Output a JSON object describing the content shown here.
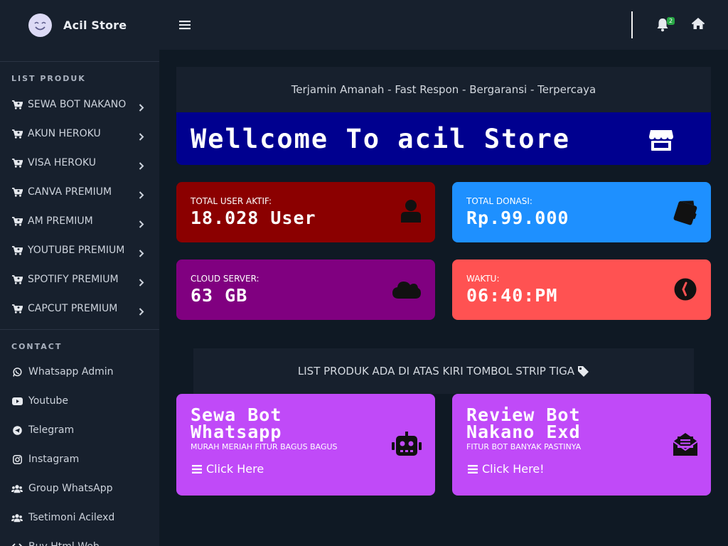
{
  "brand": {
    "name": "Acil Store"
  },
  "navbar": {
    "notification_count": "2"
  },
  "sidebar": {
    "products_heading": "LIST PRODUK",
    "products": [
      {
        "label": "SEWA BOT NAKANO"
      },
      {
        "label": "AKUN HEROKU"
      },
      {
        "label": "VISA HEROKU"
      },
      {
        "label": "CANVA PREMIUM"
      },
      {
        "label": "AM PREMIUM"
      },
      {
        "label": "YOUTUBE PREMIUM"
      },
      {
        "label": "SPOTIFY PREMIUM"
      },
      {
        "label": "CAPCUT PREMIUM"
      }
    ],
    "contact_heading": "CONTACT",
    "contacts": [
      {
        "label": "Whatsapp Admin",
        "icon": "whatsapp-icon"
      },
      {
        "label": "Youtube",
        "icon": "youtube-icon"
      },
      {
        "label": "Telegram",
        "icon": "telegram-icon"
      },
      {
        "label": "Instagram",
        "icon": "instagram-icon"
      },
      {
        "label": "Group WhatsApp",
        "icon": "users-icon"
      },
      {
        "label": "Tsetimoni Acilexd",
        "icon": "users-icon"
      },
      {
        "label": "Buy Html Web",
        "icon": "code-icon"
      }
    ]
  },
  "main": {
    "tagline": "Terjamin Amanah - Fast Respon - Bergaransi - Terpercaya",
    "welcome": "Wellcome To acil Store",
    "stats": [
      {
        "label": "TOTAL USER AKTIF:",
        "value": "18.028 User",
        "color": "#8b0000",
        "icon": "user-icon"
      },
      {
        "label": "TOTAL DONASI:",
        "value": "Rp.99.000",
        "color": "#1e90ff",
        "icon": "wallet-icon"
      },
      {
        "label": "CLOUD SERVER:",
        "value": "63 GB",
        "color": "#800080",
        "icon": "cloud-icon"
      },
      {
        "label": "WAKTU:",
        "value": "06:40:PM",
        "color": "#ff5252",
        "icon": "clock-icon"
      }
    ],
    "info": "LIST PRODUK ADA DI ATAS KIRI TOMBOL STRIP TIGA",
    "products": [
      {
        "title": "Sewa Bot Whatsapp",
        "subtitle": "MURAH MERIAH FITUR BAGUS BAGUS",
        "link": "Click Here",
        "icon": "robot-icon"
      },
      {
        "title": "Review Bot Nakano Exd",
        "subtitle": "FITUR BOT BANYAK PASTINYA",
        "link": "Click Here!",
        "icon": "envelope-open-icon"
      }
    ],
    "colors": {
      "product_bg": "#c04af8",
      "welcome_bg": "#00008f"
    }
  }
}
